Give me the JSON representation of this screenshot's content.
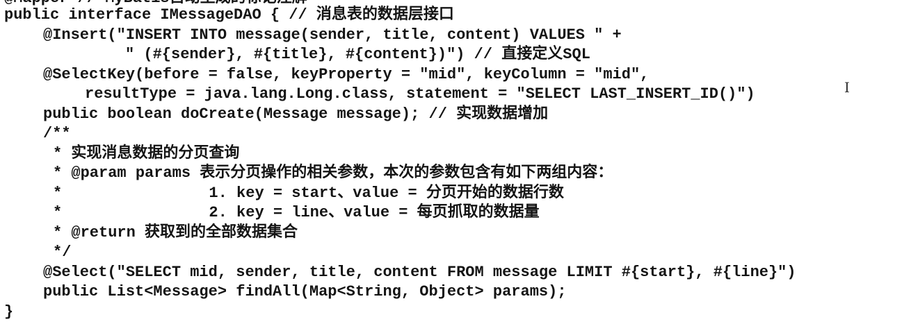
{
  "code_lines": [
    "@Mapper // MyBatis自动生成的标记注解",
    "public interface IMessageDAO { // 消息表的数据层接口",
    "@Insert(\"INSERT INTO message(sender, title, content) VALUES \" +",
    "\" (#{sender}, #{title}, #{content})\") // 直接定义SQL",
    "@SelectKey(before = false, keyProperty = \"mid\", keyColumn = \"mid\",",
    "resultType = java.lang.Long.class, statement = \"SELECT LAST_INSERT_ID()\")",
    "public boolean doCreate(Message message); // 实现数据增加",
    "/**",
    "* 实现消息数据的分页查询",
    "* @param params 表示分页操作的相关参数，本次的参数包含有如下两组内容：",
    "*                1. key = start、value = 分页开始的数据行数",
    "*                2. key = line、value = 每页抓取的数据量",
    "* @return 获取到的全部数据集合",
    "*/",
    "@Select(\"SELECT mid, sender, title, content FROM message LIMIT #{start}, #{line}\")",
    "public List<Message> findAll(Map<String, Object> params);",
    "}"
  ],
  "cursor_glyph": "I"
}
